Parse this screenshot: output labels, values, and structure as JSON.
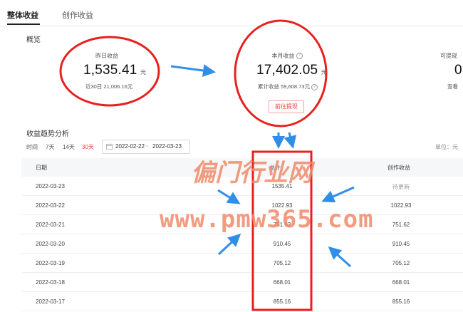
{
  "tabs": [
    {
      "label": "整体收益",
      "active": true
    },
    {
      "label": "创作收益",
      "active": false
    }
  ],
  "overview": {
    "title": "概览",
    "cards": [
      {
        "label": "昨日收益",
        "value": "1,535.41",
        "unit": "元",
        "sub": "近30日 21,006.16元"
      },
      {
        "label": "本月收益",
        "value": "17,402.05",
        "unit": "元",
        "sub": "累计收益 59,608.73元"
      },
      {
        "label": "可提现",
        "value": "0",
        "sub": "查看"
      }
    ],
    "withdraw_button": "前往提现"
  },
  "trend": {
    "title": "收益趋势分析",
    "time_label": "时间",
    "ranges": [
      "7天",
      "14天",
      "30天"
    ],
    "selected_range": "30天",
    "date_start": "2022-02-22",
    "date_sep": "~",
    "date_end": "2022-03-23",
    "unit": "单位：元"
  },
  "table": {
    "headers": [
      "日期",
      "总计",
      "创作收益"
    ],
    "rows": [
      {
        "date": "2022-03-23",
        "total": "1535.41",
        "creation": "待更新"
      },
      {
        "date": "2022-03-22",
        "total": "1022.93",
        "creation": "1022.93"
      },
      {
        "date": "2022-03-21",
        "total": "751.62",
        "creation": "751.62"
      },
      {
        "date": "2022-03-20",
        "total": "910.45",
        "creation": "910.45"
      },
      {
        "date": "2022-03-19",
        "total": "705.12",
        "creation": "705.12"
      },
      {
        "date": "2022-03-18",
        "total": "668.01",
        "creation": "668.01"
      },
      {
        "date": "2022-03-17",
        "total": "855.16",
        "creation": "855.16"
      }
    ]
  },
  "watermark": {
    "line1": "偏门行业网",
    "line2": "www.pmw365.com"
  },
  "colors": {
    "accent_red": "#e0453c",
    "annotation_red": "#e8201e",
    "annotation_blue": "#2f8fe8",
    "watermark": "#f08a6a"
  }
}
